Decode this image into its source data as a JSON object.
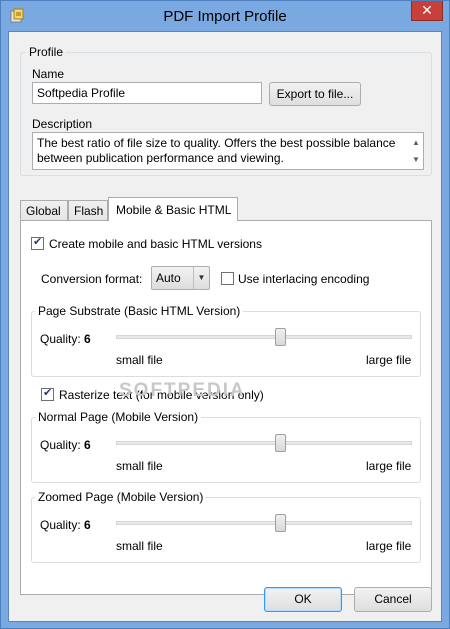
{
  "window": {
    "title": "PDF Import Profile",
    "close_label": "✕"
  },
  "profile": {
    "group_title": "Profile",
    "name_label": "Name",
    "name_value": "Softpedia Profile",
    "export_button": "Export to file...",
    "description_label": "Description",
    "description_value": "The best ratio of file size to quality. Offers the best possible balance between publication performance and viewing."
  },
  "tabs": [
    {
      "label": "Global",
      "active": false
    },
    {
      "label": "Flash",
      "active": false
    },
    {
      "label": "Mobile & Basic HTML",
      "active": true
    }
  ],
  "mobile": {
    "create_checkbox_label": "Create mobile and basic HTML versions",
    "create_checked": true,
    "conversion_format_label": "Conversion format:",
    "conversion_format_value": "Auto",
    "interlacing_label": "Use interlacing encoding",
    "interlacing_checked": false,
    "page_substrate": {
      "title": "Page Substrate (Basic HTML Version)",
      "quality_label": "Quality:",
      "quality_value": "6",
      "min_label": "small file",
      "max_label": "large file",
      "level": 0.6
    },
    "rasterize_label": "Rasterize text (for mobile version only)",
    "rasterize_checked": true,
    "normal_page": {
      "title": "Normal Page (Mobile Version)",
      "quality_label": "Quality:",
      "quality_value": "6",
      "min_label": "small file",
      "max_label": "large file",
      "level": 0.6
    },
    "zoomed_page": {
      "title": "Zoomed Page (Mobile Version)",
      "quality_label": "Quality:",
      "quality_value": "6",
      "min_label": "small file",
      "max_label": "large file",
      "level": 0.6
    }
  },
  "watermark": "SOFTPEDIA",
  "buttons": {
    "ok": "OK",
    "cancel": "Cancel"
  }
}
